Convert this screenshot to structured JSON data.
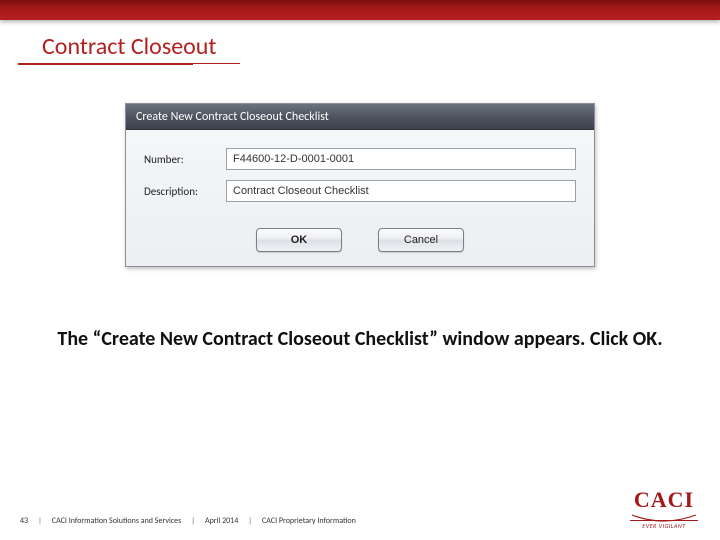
{
  "header": {
    "page_title": "Contract Closeout"
  },
  "dialog": {
    "title": "Create New Contract Closeout Checklist",
    "fields": {
      "number_label": "Number:",
      "number_value": "F44600-12-D-0001-0001",
      "description_label": "Description:",
      "description_value": "Contract Closeout Checklist"
    },
    "buttons": {
      "ok": "OK",
      "cancel": "Cancel"
    }
  },
  "caption": "The “Create New Contract Closeout Checklist” window appears.  Click OK.",
  "footer": {
    "page_number": "43",
    "org": "CACI Information Solutions and Services",
    "date": "April 2014",
    "classification": "CACI Proprietary Information",
    "separator": "|"
  },
  "logo": {
    "main": "CACI",
    "sub": "EVER VIGILANT"
  }
}
